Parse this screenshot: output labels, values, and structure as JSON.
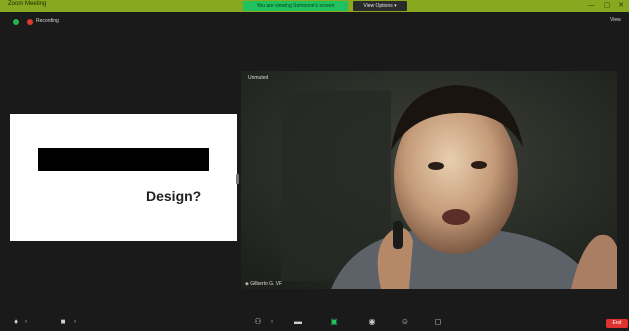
{
  "window": {
    "title": "Zoom Meeting",
    "share_banner": "You are viewing Someone's screen",
    "view_options_label": "View Options ▾",
    "controls": {
      "minimize": "—",
      "maximize": "▢",
      "close": "✕"
    }
  },
  "top_bar": {
    "recording_label": "Recording",
    "view_label": "View"
  },
  "slide": {
    "text": "Design?"
  },
  "video": {
    "top_name": "Unmuted",
    "bottom_name": "Gilberto G. VF"
  },
  "toolbar": {
    "end_label": "End"
  },
  "colors": {
    "titlebar": "#87a81f",
    "share_banner": "#1fc25e",
    "background": "#1a1a1a",
    "end_button": "#e0332f"
  }
}
